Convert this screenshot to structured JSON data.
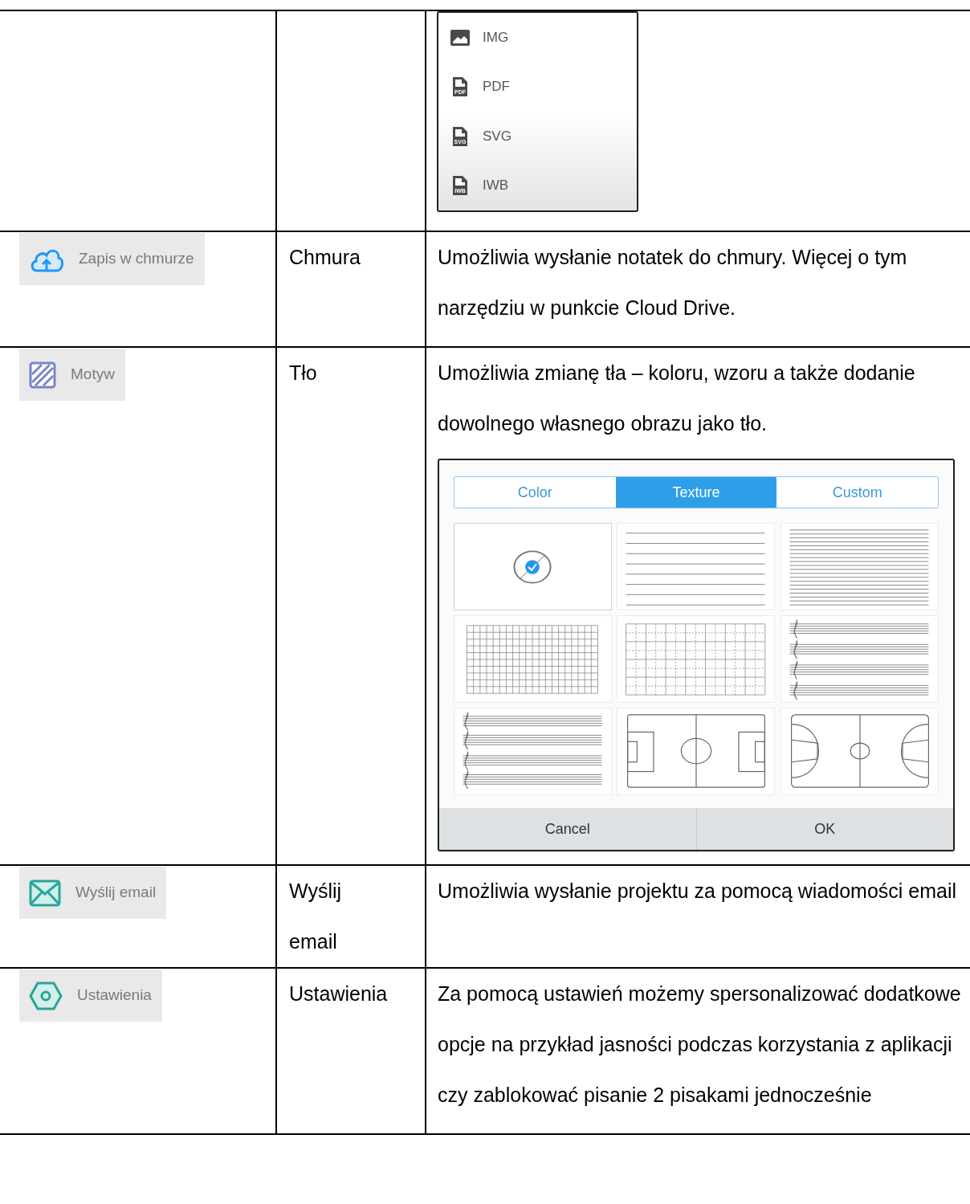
{
  "rows": [
    {
      "kind": "export_menu",
      "menu": [
        {
          "kind": "image",
          "label": "IMG"
        },
        {
          "kind": "file",
          "badge": "PDF",
          "label": "PDF"
        },
        {
          "kind": "file",
          "badge": "SVG",
          "label": "SVG"
        },
        {
          "kind": "file",
          "badge": "IWB",
          "label": "IWB"
        }
      ]
    },
    {
      "kind": "tool",
      "button": {
        "kind": "cloud",
        "label": "Zapis w chmurze"
      },
      "name": "Chmura",
      "description": "Umożliwia wysłanie notatek do chmury. Więcej o tym narzędziu w punkcie Cloud Drive."
    },
    {
      "kind": "tool",
      "button": {
        "kind": "pattern",
        "label": "Motyw"
      },
      "name": "Tło",
      "description": "Umożliwia zmianę tła – koloru, wzoru a także dodanie dowolnego własnego obrazu jako tło.",
      "dialog": {
        "tabs": [
          {
            "label": "Color",
            "selected": false
          },
          {
            "label": "Texture",
            "selected": true
          },
          {
            "label": "Custom",
            "selected": false
          }
        ],
        "textures": [
          {
            "kind": "blank",
            "selected": true
          },
          {
            "kind": "lines",
            "selected": false
          },
          {
            "kind": "dense_lines",
            "selected": false
          },
          {
            "kind": "grid",
            "selected": false
          },
          {
            "kind": "dotted_grid",
            "selected": false
          },
          {
            "kind": "staff",
            "selected": false
          },
          {
            "kind": "grand_staff",
            "selected": false
          },
          {
            "kind": "soccer",
            "selected": false
          },
          {
            "kind": "basketball",
            "selected": false
          }
        ],
        "buttons": [
          "Cancel",
          "OK"
        ]
      }
    },
    {
      "kind": "tool",
      "button": {
        "kind": "mail",
        "label": "Wyślij email"
      },
      "name": "Wyślij email",
      "description": "Umożliwia wysłanie projektu za pomocą wiadomości email"
    },
    {
      "kind": "tool",
      "button": {
        "kind": "settings",
        "label": "Ustawienia"
      },
      "name": "Ustawienia",
      "description": "Za pomocą ustawień możemy spersonalizować dodatkowe opcje na przykład jasności podczas korzystania z aplikacji czy zablokować pisanie 2 pisakami jednocześnie"
    }
  ]
}
